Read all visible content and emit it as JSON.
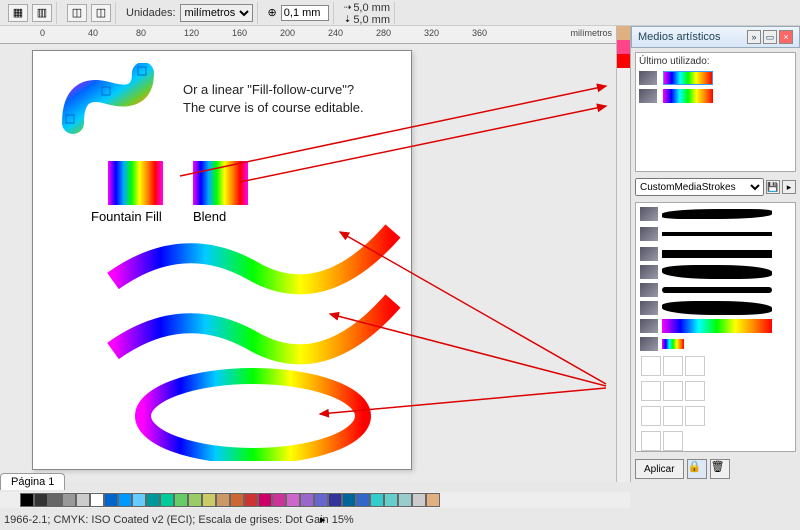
{
  "toolbar": {
    "units_label": "Unidades:",
    "units_value": "milímetros",
    "nudge_value": "0,1 mm",
    "dx_label": "5,0 mm",
    "dy_label": "5,0 mm"
  },
  "ruler": {
    "ticks": [
      "0",
      "40",
      "80",
      "120",
      "160",
      "200",
      "240",
      "280",
      "320",
      "360",
      "milímetros"
    ]
  },
  "canvas": {
    "text_line1": "Or a linear \"Fill-follow-curve\"?",
    "text_line2": "The curve is of course editable.",
    "label_fountain": "Fountain Fill",
    "label_blend": "Blend"
  },
  "panel": {
    "title": "Medios artísticos",
    "last_used_label": "Último utilizado:",
    "dropdown_value": "CustomMediaStrokes",
    "apply_label": "Aplicar"
  },
  "page_tab": "Página 1",
  "status": "1966-2.1; CMYK: ISO Coated v2 (ECI); Escala de grises: Dot Gain 15%",
  "palette": [
    "#000",
    "#333",
    "#666",
    "#999",
    "#ccc",
    "#fff",
    "#06c",
    "#09f",
    "#6cf",
    "#099",
    "#0c9",
    "#6c6",
    "#9c6",
    "#cc6",
    "#c96",
    "#c63",
    "#c33",
    "#c06",
    "#c39",
    "#c6c",
    "#96c",
    "#66c",
    "#339",
    "#069",
    "#36c",
    "#3cc",
    "#6cc",
    "#9cc",
    "#ccc",
    "#e0b080"
  ],
  "right_colors": [
    "#e0b080",
    "#f48",
    "#f00",
    "#ccc",
    "#ddd"
  ]
}
